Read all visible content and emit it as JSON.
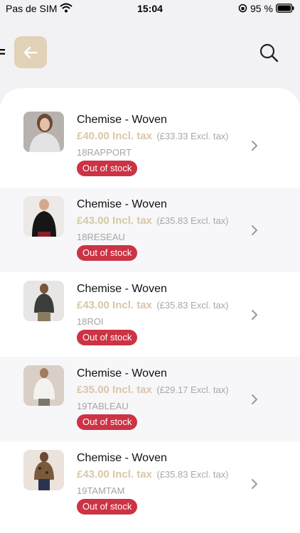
{
  "status_bar": {
    "carrier": "Pas de SIM",
    "time": "15:04",
    "battery": "95 %"
  },
  "header": {
    "back_icon": "arrow-left-icon",
    "search_icon": "search-icon",
    "accent_color": "#e1d2b8"
  },
  "products": [
    {
      "name": "Chemise - Woven",
      "price_incl": "£40.00 Incl. tax",
      "price_excl": "(£33.33 Excl. tax)",
      "sku": "18RAPPORT",
      "stock": "Out of stock"
    },
    {
      "name": "Chemise - Woven",
      "price_incl": "£43.00 Incl. tax",
      "price_excl": "(£35.83 Excl. tax)",
      "sku": "18RESEAU",
      "stock": "Out of stock"
    },
    {
      "name": "Chemise - Woven",
      "price_incl": "£43.00 Incl. tax",
      "price_excl": "(£35.83 Excl. tax)",
      "sku": "18ROI",
      "stock": "Out of stock"
    },
    {
      "name": "Chemise - Woven",
      "price_incl": "£35.00 Incl. tax",
      "price_excl": "(£29.17 Excl. tax)",
      "sku": "19TABLEAU",
      "stock": "Out of stock"
    },
    {
      "name": "Chemise - Woven",
      "price_incl": "£43.00 Incl. tax",
      "price_excl": "(£35.83 Excl. tax)",
      "sku": "19TAMTAM",
      "stock": "Out of stock"
    }
  ],
  "colors": {
    "price": "#d9c7a7",
    "out_of_stock_badge": "#cc3344"
  }
}
